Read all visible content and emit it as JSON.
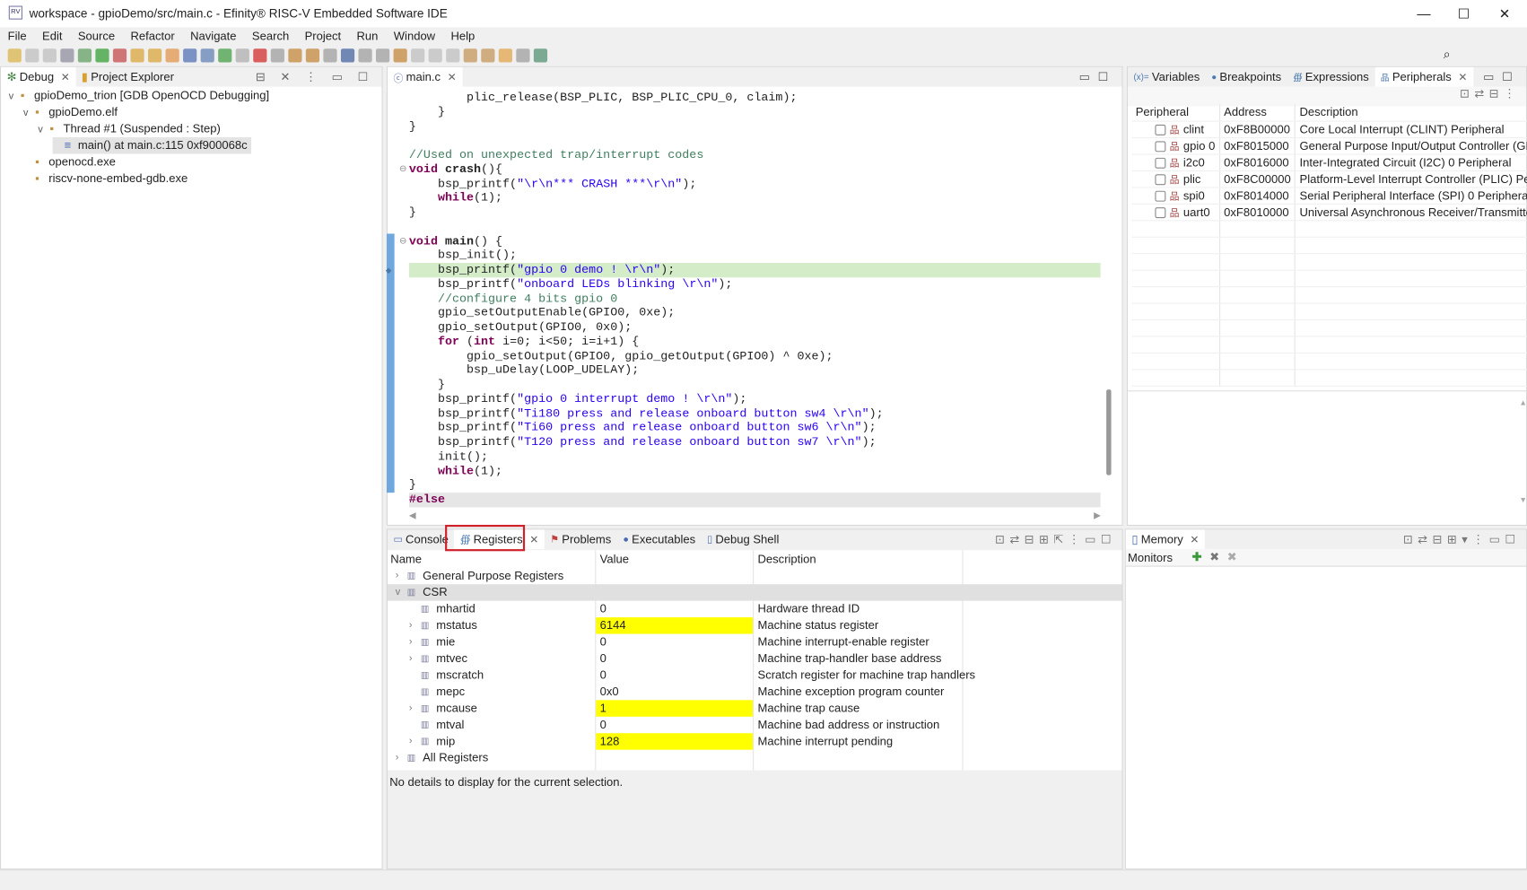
{
  "window": {
    "title": "workspace - gpioDemo/src/main.c - Efinity® RISC-V Embedded Software IDE",
    "icon": "efinity-app-icon",
    "minimize": "—",
    "maximize": "☐",
    "close": "✕"
  },
  "menu": [
    "File",
    "Edit",
    "Source",
    "Refactor",
    "Navigate",
    "Search",
    "Project",
    "Run",
    "Window",
    "Help"
  ],
  "debug_view": {
    "tabs": [
      {
        "label": "Debug",
        "icon": "bug-icon"
      },
      {
        "label": "Project Explorer",
        "icon": "folder-icon"
      }
    ],
    "tree": [
      {
        "label": "gpioDemo_trion [GDB OpenOCD Debugging]",
        "level": 0,
        "expanded": true
      },
      {
        "label": "gpioDemo.elf",
        "level": 1,
        "expanded": true
      },
      {
        "label": "Thread #1 (Suspended : Step)",
        "level": 2,
        "expanded": true
      },
      {
        "label": "main() at main.c:115 0xf900068c",
        "level": 3,
        "selected": true
      },
      {
        "label": "openocd.exe",
        "level": 1
      },
      {
        "label": "riscv-none-embed-gdb.exe",
        "level": 1
      }
    ]
  },
  "editor": {
    "tab": "main.c",
    "current_line_index": 13,
    "lines": [
      [
        [
          "n",
          "        plic_release(BSP_PLIC, BSP_PLIC_CPU_0, claim);"
        ]
      ],
      [
        [
          "n",
          "    }"
        ]
      ],
      [
        [
          "n",
          "}"
        ]
      ],
      [],
      [
        [
          "c",
          "//Used on unexpected trap/interrupt codes"
        ]
      ],
      [
        [
          "k",
          "void "
        ],
        [
          "f",
          "crash"
        ],
        [
          "n",
          "(){"
        ]
      ],
      [
        [
          "n",
          "    bsp_printf("
        ],
        [
          "s",
          "\"\\r\\n*** CRASH ***\\r\\n\""
        ],
        [
          "n",
          ");"
        ]
      ],
      [
        [
          "n",
          "    "
        ],
        [
          "k",
          "while"
        ],
        [
          "n",
          "(1);"
        ]
      ],
      [
        [
          "n",
          "}"
        ]
      ],
      [],
      [
        [
          "k",
          "void "
        ],
        [
          "f",
          "main"
        ],
        [
          "n",
          "() {"
        ]
      ],
      [
        [
          "n",
          "    bsp_init();"
        ]
      ],
      [
        [
          "n",
          "    bsp_printf("
        ],
        [
          "s",
          "\"gpio 0 demo ! \\r\\n\""
        ],
        [
          "n",
          ");"
        ]
      ],
      [
        [
          "n",
          "    bsp_printf("
        ],
        [
          "s",
          "\"onboard LEDs blinking \\r\\n\""
        ],
        [
          "n",
          ");"
        ]
      ],
      [
        [
          "c",
          "    //configure 4 bits gpio 0"
        ]
      ],
      [
        [
          "n",
          "    gpio_setOutputEnable(GPIO0, 0xe);"
        ]
      ],
      [
        [
          "n",
          "    gpio_setOutput(GPIO0, 0x0);"
        ]
      ],
      [
        [
          "n",
          "    "
        ],
        [
          "k",
          "for"
        ],
        [
          "n",
          " ("
        ],
        [
          "k",
          "int"
        ],
        [
          "n",
          " i=0; i<50; i=i+1) {"
        ]
      ],
      [
        [
          "n",
          "        gpio_setOutput(GPIO0, gpio_getOutput(GPIO0) ^ 0xe);"
        ]
      ],
      [
        [
          "n",
          "        bsp_uDelay(LOOP_UDELAY);"
        ]
      ],
      [
        [
          "n",
          "    }"
        ]
      ],
      [
        [
          "n",
          "    bsp_printf("
        ],
        [
          "s",
          "\"gpio 0 interrupt demo ! \\r\\n\""
        ],
        [
          "n",
          ");"
        ]
      ],
      [
        [
          "n",
          "    bsp_printf("
        ],
        [
          "s",
          "\"Ti180 press and release onboard button sw4 \\r\\n\""
        ],
        [
          "n",
          ");"
        ]
      ],
      [
        [
          "n",
          "    bsp_printf("
        ],
        [
          "s",
          "\"Ti60 press and release onboard button sw6 \\r\\n\""
        ],
        [
          "n",
          ");"
        ]
      ],
      [
        [
          "n",
          "    bsp_printf("
        ],
        [
          "s",
          "\"T120 press and release onboard button sw7 \\r\\n\""
        ],
        [
          "n",
          ");"
        ]
      ],
      [
        [
          "n",
          "    init();"
        ]
      ],
      [
        [
          "n",
          "    "
        ],
        [
          "k",
          "while"
        ],
        [
          "n",
          "(1);"
        ]
      ],
      [
        [
          "n",
          "}"
        ]
      ],
      [
        [
          "k",
          "#else"
        ]
      ]
    ]
  },
  "peripherals_view": {
    "tabs": [
      "Variables",
      "Breakpoints",
      "Expressions",
      "Peripherals"
    ],
    "columns": [
      "Peripheral",
      "Address",
      "Description"
    ],
    "rows": [
      {
        "name": "clint",
        "address": "0xF8B00000",
        "description": "Core Local Interrupt (CLINT) Peripheral",
        "checked": false
      },
      {
        "name": "gpio 0",
        "address": "0xF8015000",
        "description": "General Purpose Input/Output Controller (GP...",
        "checked": false
      },
      {
        "name": "i2c0",
        "address": "0xF8016000",
        "description": "Inter-Integrated Circuit (I2C) 0 Peripheral",
        "checked": false
      },
      {
        "name": "plic",
        "address": "0xF8C00000",
        "description": "Platform-Level Interrupt Controller (PLIC) Per...",
        "checked": false
      },
      {
        "name": "spi0",
        "address": "0xF8014000",
        "description": "Serial Peripheral Interface (SPI) 0 Peripheral",
        "checked": false
      },
      {
        "name": "uart0",
        "address": "0xF8010000",
        "description": "Universal Asynchronous Receiver/Transmitter...",
        "checked": false
      }
    ]
  },
  "registers_view": {
    "tabs": [
      "Console",
      "Registers",
      "Problems",
      "Executables",
      "Debug Shell"
    ],
    "active_tab": "Registers",
    "highlight_color": "#ffff00",
    "annotation_color": "#d0202a",
    "columns": [
      "Name",
      "Value",
      "Description"
    ],
    "rows": [
      {
        "name": "General Purpose Registers",
        "value": "",
        "description": "",
        "level": 0,
        "expander": ">"
      },
      {
        "name": "CSR",
        "value": "",
        "description": "",
        "level": 0,
        "expander": "v",
        "selected": true
      },
      {
        "name": "mhartid",
        "value": "0",
        "description": "Hardware thread ID",
        "level": 1,
        "expander": ""
      },
      {
        "name": "mstatus",
        "value": "6144",
        "description": "Machine status register",
        "level": 1,
        "expander": ">",
        "changed": true
      },
      {
        "name": "mie",
        "value": "0",
        "description": "Machine interrupt-enable register",
        "level": 1,
        "expander": ">"
      },
      {
        "name": "mtvec",
        "value": "0",
        "description": "Machine trap-handler base address",
        "level": 1,
        "expander": ">"
      },
      {
        "name": "mscratch",
        "value": "0",
        "description": "Scratch register for machine trap handlers",
        "level": 1,
        "expander": ""
      },
      {
        "name": "mepc",
        "value": "0x0",
        "description": "Machine exception program counter",
        "level": 1,
        "expander": ""
      },
      {
        "name": "mcause",
        "value": "1",
        "description": "Machine trap cause",
        "level": 1,
        "expander": ">",
        "changed": true
      },
      {
        "name": "mtval",
        "value": "0",
        "description": "Machine bad address or instruction",
        "level": 1,
        "expander": ""
      },
      {
        "name": "mip",
        "value": "128",
        "description": "Machine interrupt pending",
        "level": 1,
        "expander": ">",
        "changed": true
      },
      {
        "name": "All Registers",
        "value": "",
        "description": "",
        "level": 0,
        "expander": ">"
      }
    ],
    "details": "No details to display for the current selection."
  },
  "memory_view": {
    "tab": "Memory",
    "monitors_label": "Monitors"
  }
}
